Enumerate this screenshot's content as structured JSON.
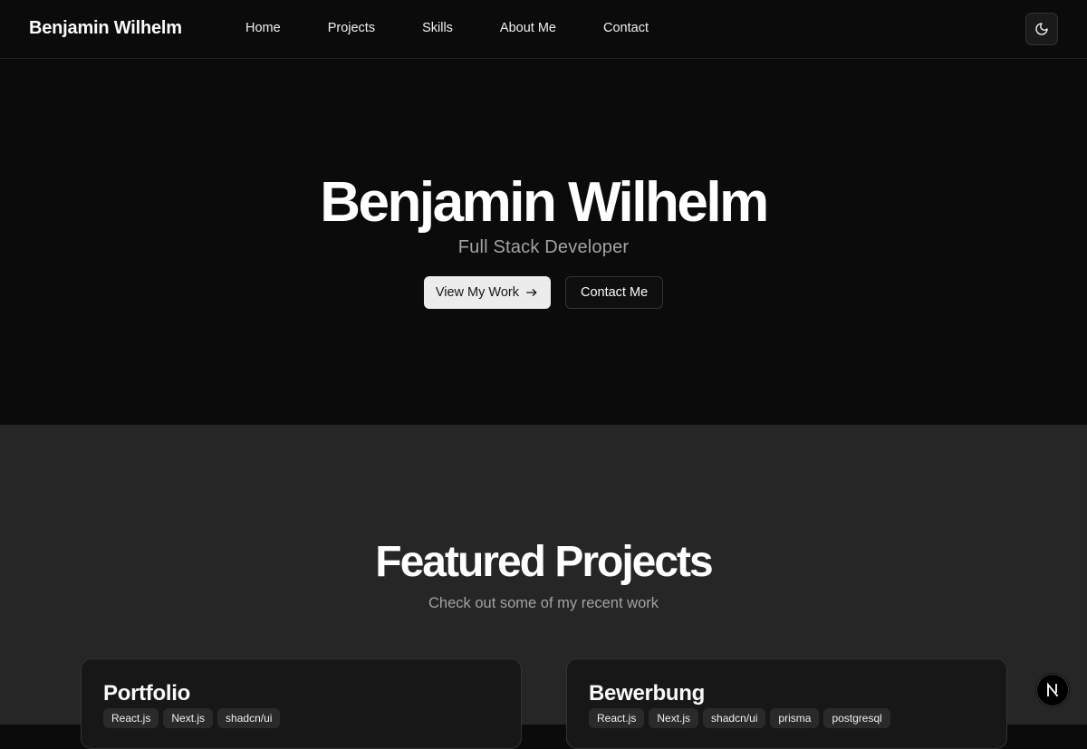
{
  "header": {
    "brand": "Benjamin Wilhelm",
    "nav": [
      "Home",
      "Projects",
      "Skills",
      "About Me",
      "Contact"
    ],
    "theme_toggle_icon": "moon-icon"
  },
  "hero": {
    "title": "Benjamin Wilhelm",
    "subtitle": "Full Stack Developer",
    "primary_button": "View My Work",
    "primary_button_icon": "arrow-right-icon",
    "secondary_button": "Contact Me"
  },
  "projects": {
    "title": "Featured Projects",
    "subtitle": "Check out some of my recent work",
    "cards": [
      {
        "title": "Portfolio",
        "tags": [
          "React.js",
          "Next.js",
          "shadcn/ui"
        ]
      },
      {
        "title": "Bewerbung",
        "tags": [
          "React.js",
          "Next.js",
          "shadcn/ui",
          "prisma",
          "postgresql"
        ]
      }
    ]
  },
  "next_badge": "N",
  "colors": {
    "background": "#0b0b0b",
    "section_background": "#262626",
    "card_background": "#171717",
    "muted_text": "#a3a3a3",
    "primary_button": "#ececec"
  }
}
